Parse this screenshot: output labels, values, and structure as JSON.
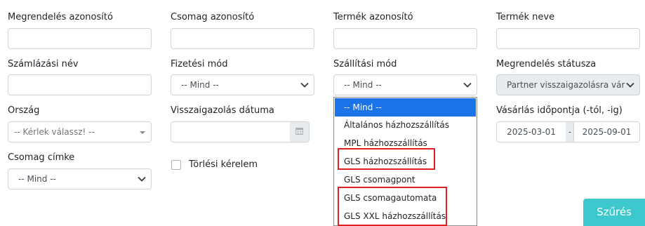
{
  "filters": {
    "order_id": {
      "label": "Megrendelés azonosító",
      "value": ""
    },
    "package_id": {
      "label": "Csomag azonosító",
      "value": ""
    },
    "product_id": {
      "label": "Termék azonosító",
      "value": ""
    },
    "product_name": {
      "label": "Termék neve",
      "value": ""
    },
    "billing_name": {
      "label": "Számlázási név",
      "value": ""
    },
    "payment_method": {
      "label": "Fizetési mód",
      "value": "-- Mind --"
    },
    "shipping_method": {
      "label": "Szállítási mód",
      "value": "-- Mind --"
    },
    "order_status": {
      "label": "Megrendelés státusza",
      "value": "Partner visszaigazolásra vár"
    },
    "country": {
      "label": "Ország",
      "placeholder": "-- Kérlek válassz! --"
    },
    "confirmation_date": {
      "label": "Visszaigazolás dátuma",
      "value": ""
    },
    "purchase_date": {
      "label": "Vásárlás időpontja (-tól, -ig)",
      "from": "2025-03-01",
      "separator": "-",
      "to": "2025-09-01"
    },
    "package_label": {
      "label": "Csomag címke",
      "value": "-- Mind --"
    },
    "delete_request": {
      "label": "Törlési kérelem",
      "checked": false
    }
  },
  "shipping_dropdown": {
    "options": [
      "-- Mind --",
      "Általános házhozszállítás",
      "MPL házhozszállítás",
      "GLS házhozszállítás",
      "GLS csomagpont",
      "GLS csomagautomata",
      "GLS XXL házhozszállítás"
    ],
    "selected_index": 0,
    "selected_color": "#1a73e8",
    "highlight_color": "#e02020"
  },
  "actions": {
    "filter_button": "Szűrés",
    "filter_button_color": "#3cc8cc"
  },
  "icons": {
    "select_chevron": "chevron-down-icon",
    "calendar": "calendar-icon",
    "select2_caret": "caret-down-icon"
  }
}
